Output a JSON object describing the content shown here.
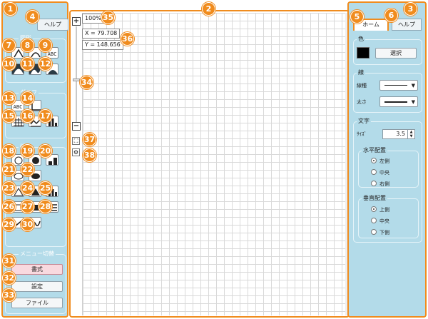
{
  "left_panel": {
    "help_tab": "ヘルプ",
    "group1_label": "図形",
    "group2_label": "グラフ",
    "group3_label": "描画",
    "abc_glyph": "ABC",
    "menu_switch_label": "メニュー切替",
    "menu_buttons": [
      "書式",
      "設定",
      "ファイル"
    ]
  },
  "canvas": {
    "zoom_plus": "+",
    "zoom_minus": "−",
    "zoom_level": "100%",
    "x_readout": "X = 79.708",
    "y_readout": "Y = 148.656",
    "fit_icon": "⛶",
    "settings_icon": "⚙"
  },
  "right_panel": {
    "tabs": [
      "ホーム",
      "ヘルプ"
    ],
    "color": {
      "title": "色",
      "swatch_hex": "#000000",
      "select_button": "選択"
    },
    "line": {
      "title": "線",
      "type_label": "線種",
      "width_label": "太さ"
    },
    "text": {
      "title": "文字",
      "size_label": "ｻｲｽﾞ",
      "size_value": "3.5",
      "halign": {
        "title": "水平配置",
        "options": [
          "左側",
          "中央",
          "右側"
        ],
        "selected": "左側"
      },
      "valign": {
        "title": "垂直配置",
        "options": [
          "上側",
          "中央",
          "下側"
        ],
        "selected": "上側"
      }
    }
  },
  "callouts": [
    "1",
    "2",
    "3",
    "4",
    "5",
    "6",
    "7",
    "8",
    "9",
    "10",
    "11",
    "12",
    "13",
    "14",
    "15",
    "16",
    "17",
    "18",
    "19",
    "20",
    "21",
    "22",
    "23",
    "24",
    "25",
    "26",
    "27",
    "28",
    "29",
    "30",
    "31",
    "32",
    "33",
    "34",
    "35",
    "36",
    "37",
    "38"
  ],
  "colors": {
    "accent": "#f08c1e",
    "panel": "#b3dbe9",
    "active_menu": "#f9d9df"
  }
}
